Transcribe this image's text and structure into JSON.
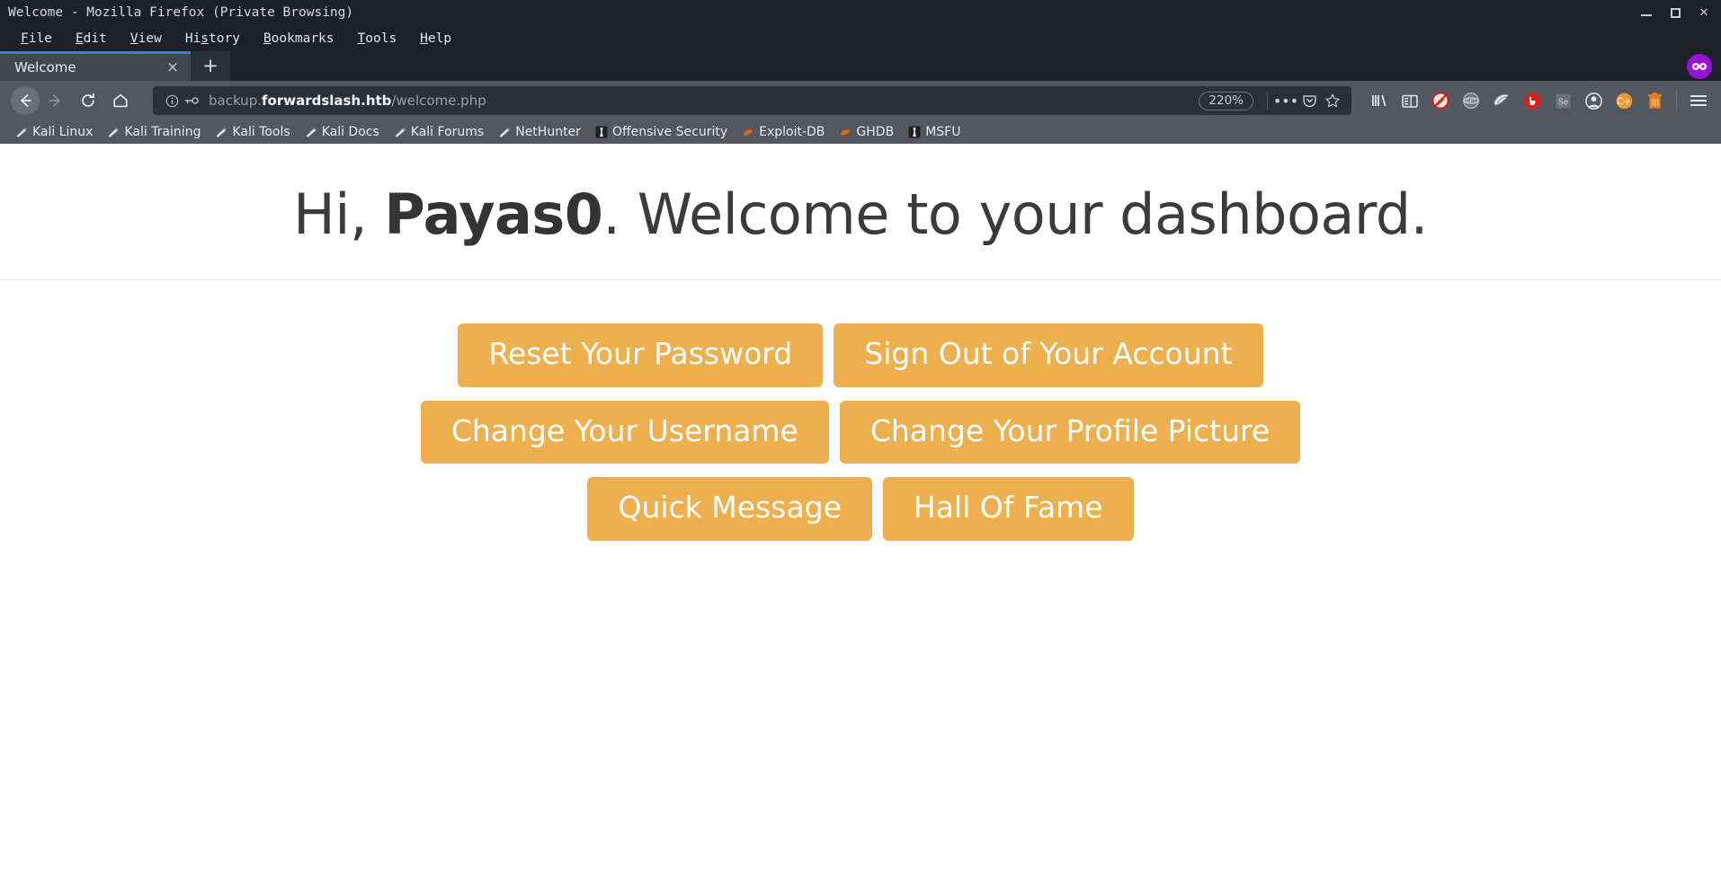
{
  "window": {
    "title": "Welcome - Mozilla Firefox (Private Browsing)",
    "controls": {
      "minimize": "minimize",
      "maximize": "maximize",
      "close": "✕"
    }
  },
  "menubar": {
    "items": [
      {
        "label": "File",
        "accel": "F"
      },
      {
        "label": "Edit",
        "accel": "E"
      },
      {
        "label": "View",
        "accel": "V"
      },
      {
        "label": "History",
        "accel": "s"
      },
      {
        "label": "Bookmarks",
        "accel": "B"
      },
      {
        "label": "Tools",
        "accel": "T"
      },
      {
        "label": "Help",
        "accel": "H"
      }
    ]
  },
  "tabs": {
    "active": {
      "label": "Welcome",
      "close": "×"
    },
    "newtab_label": "+",
    "private_badge": "∞"
  },
  "navbar": {
    "back": "←",
    "forward": "→",
    "reload": "⟳",
    "home": "home-icon",
    "url": {
      "prefix": "backup.",
      "host": "forwardslash.htb",
      "path": "/welcome.php",
      "full": "backup.forwardslash.htb/welcome.php",
      "identity_icon": "info-icon",
      "login_icon": "key-icon"
    },
    "zoom_level": "220%",
    "page_actions": "•••",
    "pocket": "pocket-icon",
    "bookmark_star": "☆",
    "extensions": [
      "library-icon",
      "sidebar-icon",
      "noscript-icon",
      "grey-badge-icon",
      "wappalyzer-icon",
      "ublock-origin-icon",
      "se-extension-icon",
      "account-icon",
      "cookie-quick-manager-icon",
      "trash-icon"
    ],
    "menu": "☰"
  },
  "bookmarks": {
    "items": [
      {
        "label": "Kali Linux",
        "icon": "kali-icon"
      },
      {
        "label": "Kali Training",
        "icon": "kali-icon"
      },
      {
        "label": "Kali Tools",
        "icon": "kali-icon"
      },
      {
        "label": "Kali Docs",
        "icon": "kali-icon"
      },
      {
        "label": "Kali Forums",
        "icon": "kali-icon"
      },
      {
        "label": "NetHunter",
        "icon": "kali-icon"
      },
      {
        "label": "Offensive Security",
        "icon": "offsec-icon"
      },
      {
        "label": "Exploit-DB",
        "icon": "exploitdb-icon"
      },
      {
        "label": "GHDB",
        "icon": "exploitdb-icon"
      },
      {
        "label": "MSFU",
        "icon": "offsec-icon"
      }
    ]
  },
  "page": {
    "greeting_prefix": "Hi, ",
    "username": "Payas0",
    "greeting_suffix": ". Welcome to your dashboard.",
    "buttons": [
      [
        {
          "label": "Reset Your Password"
        },
        {
          "label": "Sign Out of Your Account"
        }
      ],
      [
        {
          "label": "Change Your Username"
        },
        {
          "label": "Change Your Profile Picture"
        }
      ],
      [
        {
          "label": "Quick Message"
        },
        {
          "label": "Hall Of Fame"
        }
      ]
    ]
  },
  "colors": {
    "button_bg": "#eeaf4f",
    "button_text": "#ffffff",
    "chrome_dark": "#1c2028",
    "chrome_toolbar": "#53575f",
    "tab_active": "#42464f",
    "tab_accent": "#3c7bd9",
    "private_purple": "#9b10d8",
    "heading_text": "#3b3b3b"
  }
}
